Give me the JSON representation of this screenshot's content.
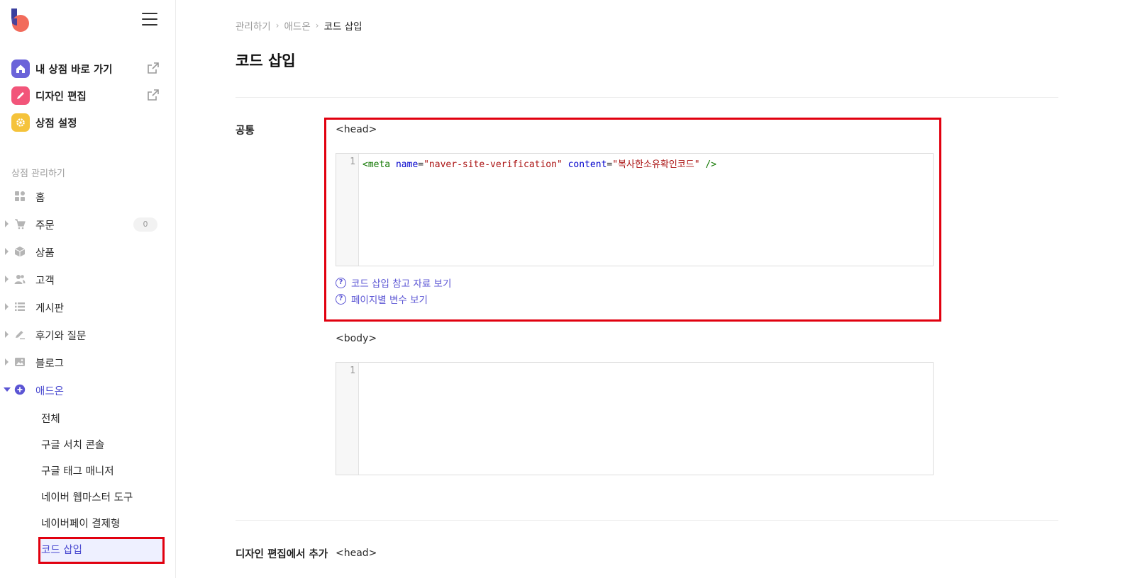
{
  "sidebar": {
    "quick_links": [
      {
        "label": "내 상점 바로 가기",
        "icon": "home-icon",
        "color": "#6b63d9"
      },
      {
        "label": "디자인 편집",
        "icon": "pencil-icon",
        "color": "#f2557a"
      },
      {
        "label": "상점 설정",
        "icon": "gear-icon",
        "color": "#f5c33b"
      }
    ],
    "section_title": "상점 관리하기",
    "nav": [
      {
        "label": "홈",
        "icon": "dashboard-icon"
      },
      {
        "label": "주문",
        "icon": "cart-icon",
        "badge": "0"
      },
      {
        "label": "상품",
        "icon": "box-icon"
      },
      {
        "label": "고객",
        "icon": "users-icon"
      },
      {
        "label": "게시판",
        "icon": "list-icon"
      },
      {
        "label": "후기와 질문",
        "icon": "edit-icon"
      },
      {
        "label": "블로그",
        "icon": "image-icon"
      },
      {
        "label": "애드온",
        "icon": "plus-circle-icon"
      }
    ],
    "addon_sub": [
      "전체",
      "구글 서치 콘솔",
      "구글 태그 매니저",
      "네이버 웹마스터 도구",
      "네이버페이 결제형",
      "코드 삽입"
    ]
  },
  "breadcrumb": [
    "관리하기",
    "애드온",
    "코드 삽입"
  ],
  "page_title": "코드 삽입",
  "common": {
    "label": "공통",
    "head_label": "<head>",
    "head_code": {
      "line": "1",
      "tag_open": "<meta",
      "attr1": "name",
      "val1": "\"naver-site-verification\"",
      "attr2": "content",
      "val2": "\"복사한소유확인코드\"",
      "tag_close": "/>"
    },
    "help_links": [
      "코드 삽입 참고 자료 보기",
      "페이지별 변수 보기"
    ],
    "body_label": "<body>",
    "body_line": "1"
  },
  "design": {
    "label": "디자인 편집에서 추가",
    "head_label": "<head>"
  },
  "colors": {
    "accent": "#5b55d4",
    "highlight": "#e1000f"
  }
}
